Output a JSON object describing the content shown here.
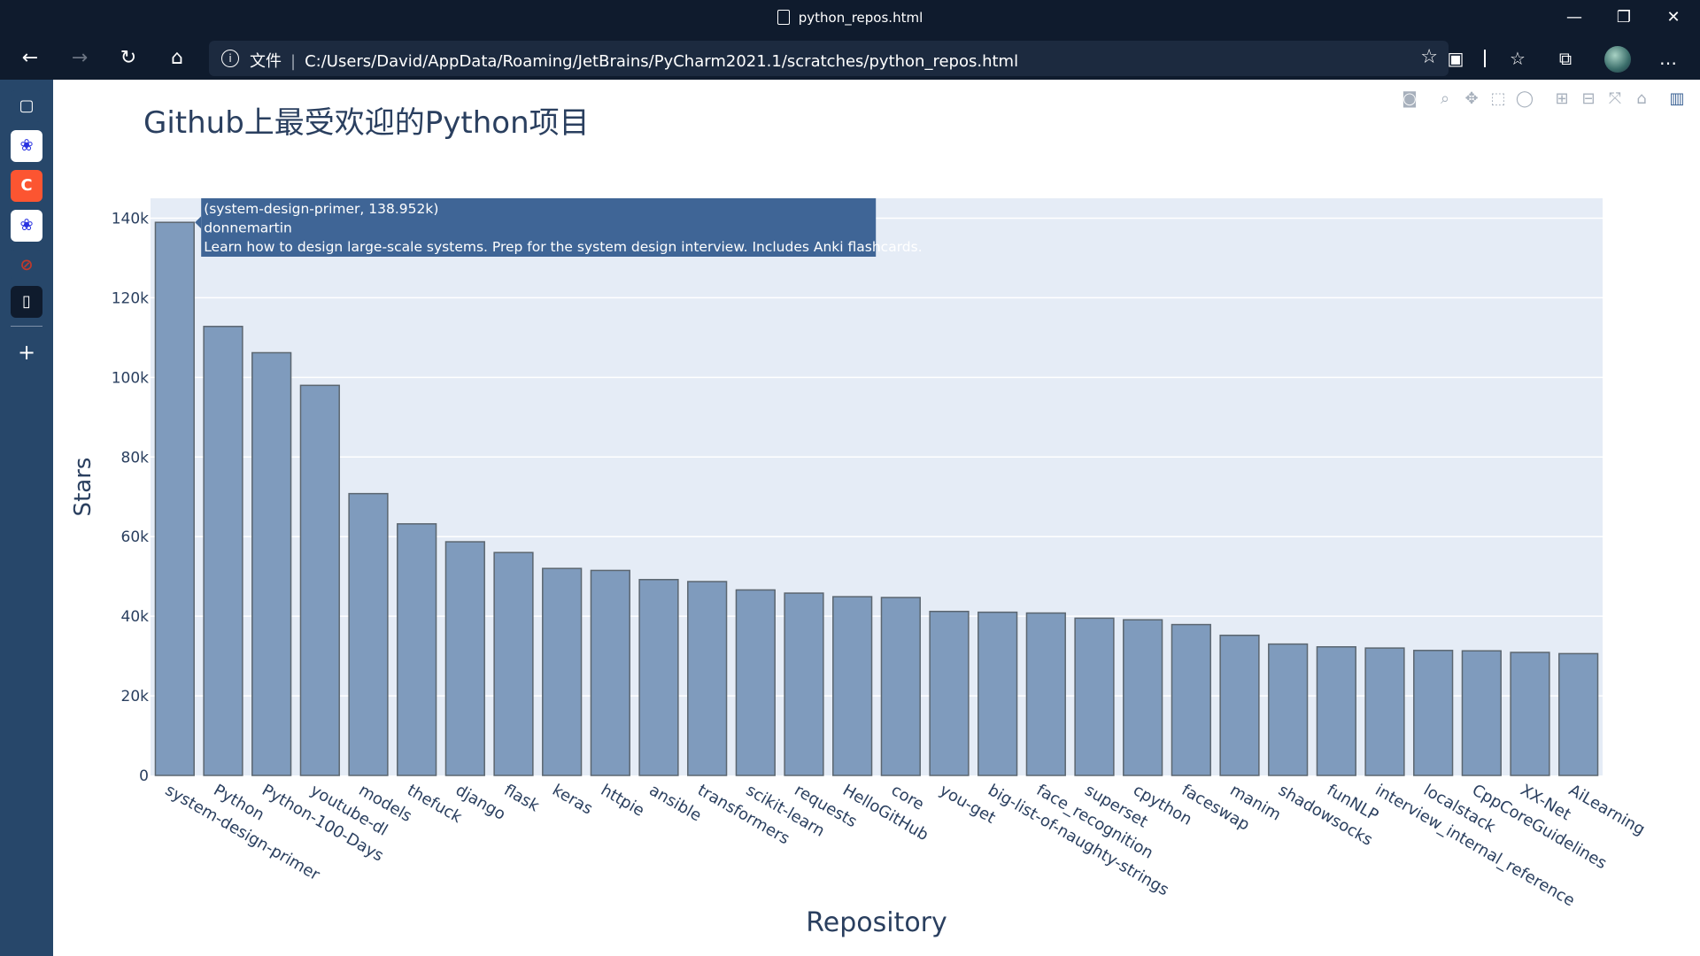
{
  "window": {
    "title": "python_repos.html",
    "buttons": {
      "minimize": "—",
      "maximize": "❐",
      "close": "✕"
    }
  },
  "toolbar": {
    "back": "←",
    "forward": "→",
    "refresh": "↻",
    "home": "⌂",
    "info": "i",
    "file_label": "文件",
    "url": "C:/Users/David/AppData/Roaming/JetBrains/PyCharm2021.1/scratches/python_repos.html",
    "add_favorite": "☆",
    "reading_mode": "▣",
    "favorites": "☆",
    "collections": "⧉",
    "more": "…"
  },
  "sidebar": {
    "items": [
      {
        "name": "tab-actions",
        "glyph": "▢",
        "bg": "#27476a",
        "fg": "#ffffff"
      },
      {
        "name": "baidu-1",
        "glyph": "❀",
        "bg": "#ffffff",
        "fg": "#2932e1"
      },
      {
        "name": "csdn",
        "glyph": "C",
        "bg": "#fc5531",
        "fg": "#ffffff"
      },
      {
        "name": "baidu-2",
        "glyph": "❀",
        "bg": "#ffffff",
        "fg": "#2932e1"
      },
      {
        "name": "blocked",
        "glyph": "⊘",
        "bg": "#27476a",
        "fg": "#c0392b"
      },
      {
        "name": "current-page",
        "glyph": "▯",
        "bg": "#0f1b2d",
        "fg": "#ffffff"
      }
    ],
    "add": "+"
  },
  "modebar": {
    "icons": [
      "camera-icon",
      "zoom-icon",
      "pan-icon",
      "box-select-icon",
      "lasso-icon",
      "zoom-in-icon",
      "zoom-out-icon",
      "autoscale-icon",
      "reset-axes-icon",
      "plotly-logo-icon"
    ],
    "glyphs": [
      "◙",
      "⌕",
      "✥",
      "⬚",
      "◯",
      "⊞",
      "⊟",
      "⤧",
      "⌂",
      "▥"
    ]
  },
  "chart_data": {
    "type": "bar",
    "title": "Github上最受欢迎的Python项目",
    "xlabel": "Repository",
    "ylabel": "Stars",
    "ylim": [
      0,
      145000
    ],
    "yticks": [
      0,
      20000,
      40000,
      60000,
      80000,
      100000,
      120000,
      140000
    ],
    "ytick_labels": [
      "0",
      "20k",
      "40k",
      "60k",
      "80k",
      "100k",
      "120k",
      "140k"
    ],
    "grid": true,
    "bar_color": "#7f9bbd",
    "bar_edge_color": "#5b6670",
    "plot_bg": "#e5ecf6",
    "categories": [
      "system-design-primer",
      "Python",
      "Python-100-Days",
      "youtube-dl",
      "models",
      "thefuck",
      "django",
      "flask",
      "keras",
      "httpie",
      "ansible",
      "transformers",
      "scikit-learn",
      "requests",
      "HelloGitHub",
      "core",
      "you-get",
      "big-list-of-naughty-strings",
      "face_recognition",
      "superset",
      "cpython",
      "faceswap",
      "manim",
      "shadowsocks",
      "funNLP",
      "interview_internal_reference",
      "localstack",
      "CppCoreGuidelines",
      "XX-Net",
      "AiLearning"
    ],
    "values": [
      138952,
      112800,
      106200,
      98000,
      70800,
      63200,
      58700,
      56000,
      52000,
      51500,
      49200,
      48700,
      46600,
      45800,
      44900,
      44700,
      41200,
      41000,
      40800,
      39500,
      39100,
      37900,
      35200,
      33000,
      32300,
      32000,
      31400,
      31300,
      30900,
      30600
    ],
    "tooltip": {
      "title": "(system-design-primer, 138.952k)",
      "owner": "donnemartin",
      "description": "Learn how to design large-scale systems. Prep for the system design interview.  Includes Anki flashcards.",
      "bg": "#3f6596",
      "bar_index": 0
    }
  }
}
